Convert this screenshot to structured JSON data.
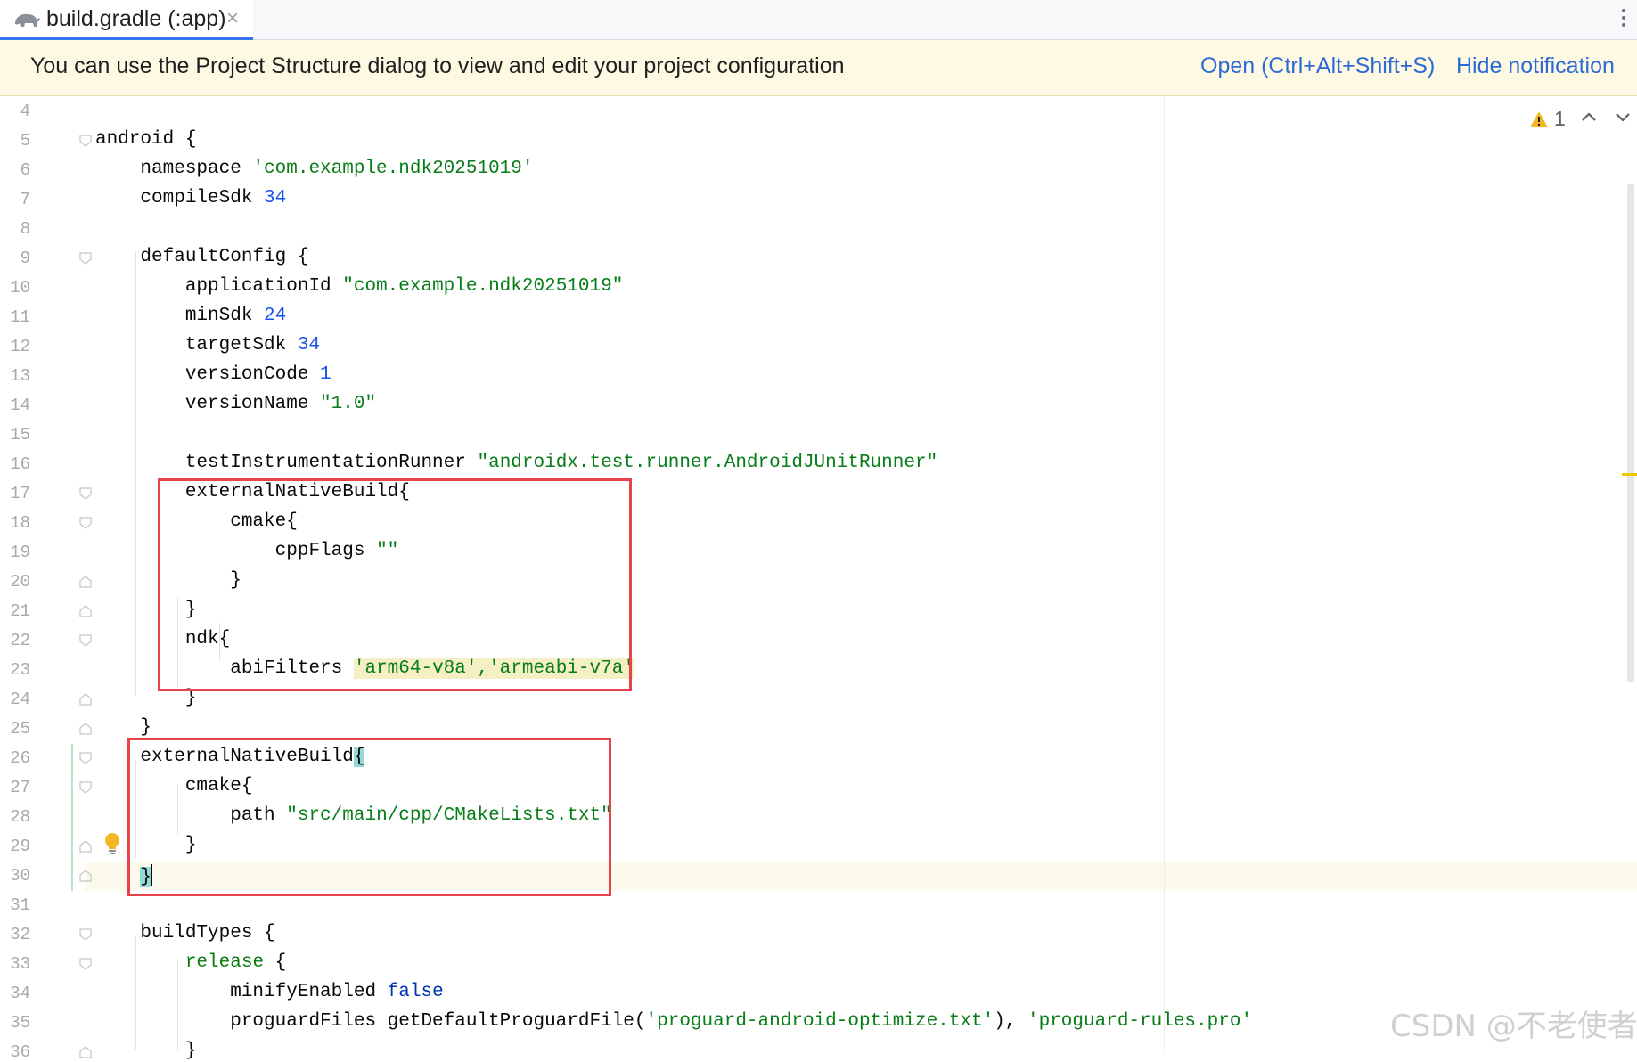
{
  "tab": {
    "title": "build.gradle (:app)",
    "close": "×",
    "icon": "gradle-elephant-icon"
  },
  "notification": {
    "text": "You can use the Project Structure dialog to view and edit your project configuration",
    "open_link": "Open (Ctrl+Alt+Shift+S)",
    "hide_link": "Hide notification"
  },
  "inspections": {
    "warning_count": "1"
  },
  "lines": [
    {
      "n": "4",
      "code": []
    },
    {
      "n": "5",
      "code": [
        [
          "android {",
          ""
        ]
      ]
    },
    {
      "n": "6",
      "code": [
        [
          "    namespace ",
          ""
        ],
        [
          "'com.example.ndk20251019'",
          "str"
        ]
      ]
    },
    {
      "n": "7",
      "code": [
        [
          "    compileSdk ",
          ""
        ],
        [
          "34",
          "num"
        ]
      ]
    },
    {
      "n": "8",
      "code": []
    },
    {
      "n": "9",
      "code": [
        [
          "    defaultConfig {",
          ""
        ]
      ]
    },
    {
      "n": "10",
      "code": [
        [
          "        applicationId ",
          ""
        ],
        [
          "\"com.example.ndk20251019\"",
          "str"
        ]
      ]
    },
    {
      "n": "11",
      "code": [
        [
          "        minSdk ",
          ""
        ],
        [
          "24",
          "num"
        ]
      ]
    },
    {
      "n": "12",
      "code": [
        [
          "        targetSdk ",
          ""
        ],
        [
          "34",
          "num"
        ]
      ]
    },
    {
      "n": "13",
      "code": [
        [
          "        versionCode ",
          ""
        ],
        [
          "1",
          "num"
        ]
      ]
    },
    {
      "n": "14",
      "code": [
        [
          "        versionName ",
          ""
        ],
        [
          "\"1.0\"",
          "str"
        ]
      ]
    },
    {
      "n": "15",
      "code": []
    },
    {
      "n": "16",
      "code": [
        [
          "        testInstrumentationRunner ",
          ""
        ],
        [
          "\"androidx.test.runner.AndroidJUnitRunner\"",
          "str"
        ]
      ]
    },
    {
      "n": "17",
      "code": [
        [
          "        externalNativeBuild{",
          ""
        ]
      ]
    },
    {
      "n": "18",
      "code": [
        [
          "            cmake{",
          ""
        ]
      ]
    },
    {
      "n": "19",
      "code": [
        [
          "                cppFlags ",
          ""
        ],
        [
          "\"\"",
          "str"
        ]
      ]
    },
    {
      "n": "20",
      "code": [
        [
          "            }",
          ""
        ]
      ]
    },
    {
      "n": "21",
      "code": [
        [
          "        }",
          ""
        ]
      ]
    },
    {
      "n": "22",
      "code": [
        [
          "        ndk{",
          ""
        ]
      ]
    },
    {
      "n": "23",
      "code": [
        [
          "            abiFilters ",
          ""
        ],
        [
          "'arm64-v8a','armeabi-v7a'",
          "str hl"
        ]
      ]
    },
    {
      "n": "24",
      "code": [
        [
          "        }",
          ""
        ]
      ]
    },
    {
      "n": "25",
      "code": [
        [
          "    }",
          ""
        ]
      ]
    },
    {
      "n": "26",
      "code": [
        [
          "    externalNativeBuild",
          ""
        ],
        [
          "{",
          "brace-hl"
        ]
      ]
    },
    {
      "n": "27",
      "code": [
        [
          "        cmake{",
          ""
        ]
      ]
    },
    {
      "n": "28",
      "code": [
        [
          "            path ",
          ""
        ],
        [
          "\"src/main/cpp/CMakeLists.txt\"",
          "str"
        ]
      ]
    },
    {
      "n": "29",
      "code": [
        [
          "        }",
          ""
        ]
      ]
    },
    {
      "n": "30",
      "code": [
        [
          "    ",
          ""
        ],
        [
          "}",
          "brace-hl"
        ]
      ]
    },
    {
      "n": "31",
      "code": []
    },
    {
      "n": "32",
      "code": [
        [
          "    buildTypes {",
          ""
        ]
      ]
    },
    {
      "n": "33",
      "code": [
        [
          "        ",
          ""
        ],
        [
          "release",
          "kw"
        ],
        [
          " {",
          ""
        ]
      ]
    },
    {
      "n": "34",
      "code": [
        [
          "            minifyEnabled ",
          ""
        ],
        [
          "false",
          "blue"
        ]
      ]
    },
    {
      "n": "35",
      "code": [
        [
          "            proguardFiles getDefaultProguardFile(",
          ""
        ],
        [
          "'proguard-android-optimize.txt'",
          "str"
        ],
        [
          "), ",
          ""
        ],
        [
          "'proguard-rules.pro'",
          "str"
        ]
      ]
    },
    {
      "n": "36",
      "code": [
        [
          "        }",
          ""
        ]
      ]
    }
  ],
  "watermark": "CSDN @不老使者"
}
